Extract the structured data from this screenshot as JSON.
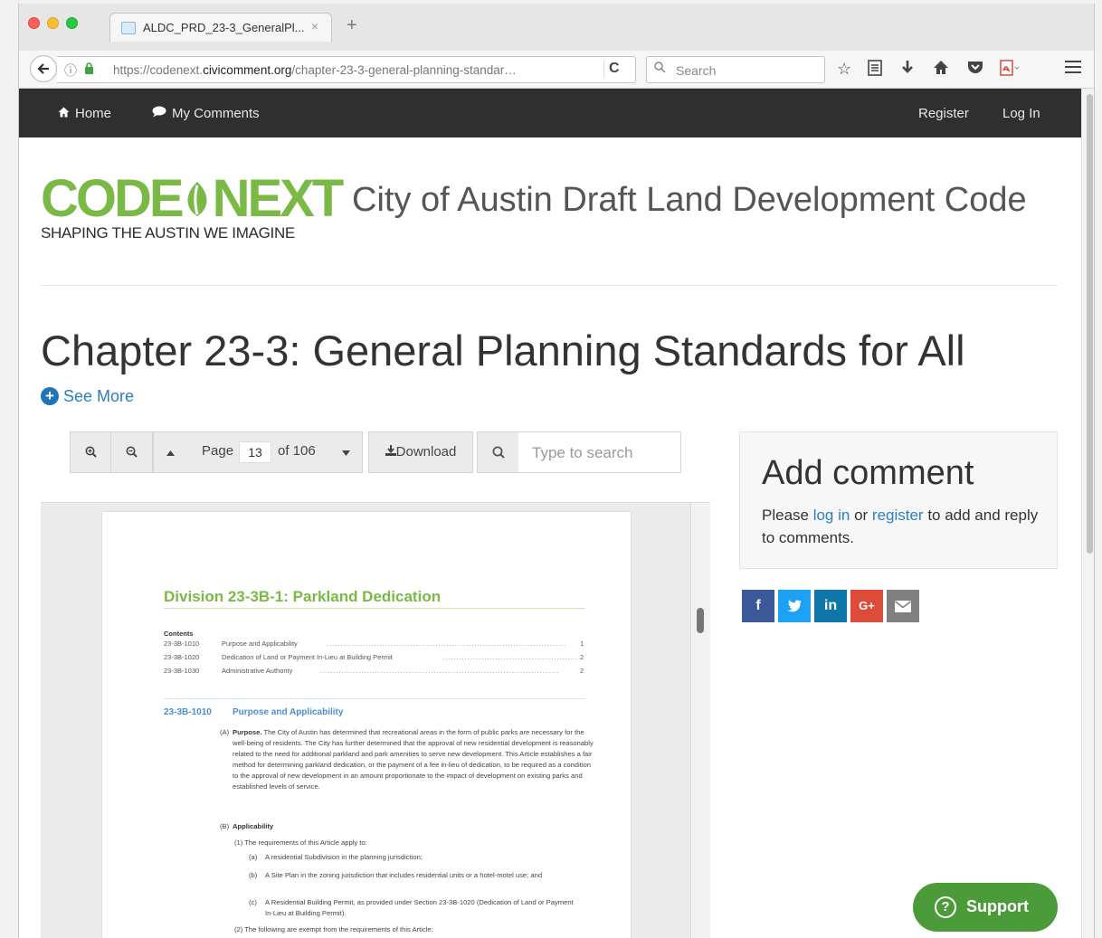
{
  "browser": {
    "tab_title": "ALDC_PRD_23-3_GeneralPl...",
    "tab_close": "×",
    "new_tab": "+",
    "url_prefix": "https://codenext.",
    "url_domain": "civicomment.org",
    "url_path": "/chapter-23-3-general-planning-standar…",
    "search_placeholder": "Search"
  },
  "site_nav": {
    "home": "Home",
    "my_comments": "My Comments",
    "register": "Register",
    "login": "Log In"
  },
  "logo": {
    "word_left": "CODE",
    "word_right": "NEXT",
    "tagline": "SHAPING THE AUSTIN WE IMAGINE"
  },
  "site_title": "City of Austin Draft Land Development Code",
  "page_title": "Chapter 23-3: General Planning Standards for All",
  "see_more": "See More",
  "viewer_toolbar": {
    "page_label": "Page",
    "page_current": "13",
    "page_total": "of 106",
    "download": "Download",
    "search_placeholder": "Type to search"
  },
  "document": {
    "division_title": "Division 23-3B-1: Parkland Dedication",
    "contents_label": "Contents",
    "toc": [
      {
        "num": "23-3B-1010",
        "title": "Purpose and Applicability",
        "page": "1"
      },
      {
        "num": "23-3B-1020",
        "title": "Dedication of Land or Payment In-Lieu at Building Permit",
        "page": "2"
      },
      {
        "num": "23-3B-1030",
        "title": "Administrative Authority",
        "page": "2"
      }
    ],
    "section_num": "23-3B-1010",
    "section_title": "Purpose and Applicability",
    "a_label": "(A)",
    "a_head": "Purpose.",
    "a_text": "The City of Austin has determined that recreational areas in the form of public parks are necessary for the well-being of residents. The City has further determined that the approval of new residential development is reasonably related to the need for additional parkland and park amenities to serve new development. This Article establishes a fair method for determining parkland dedication, or the payment of a fee in-lieu of dedication, to be required as a condition to the approval of new development in an amount proportionate to the impact of development on existing parks and established levels of service.",
    "b_label": "(B)",
    "b_head": "Applicability",
    "b1": "(1)  The requirements of this Article apply to:",
    "b1a_label": "(a)",
    "b1a": "A residential Subdivision in the planning jurisdiction;",
    "b1b_label": "(b)",
    "b1b": "A Site Plan in the zoning jurisdiction that includes residential units or a hotel-motel use; and",
    "b1c_label": "(c)",
    "b1c": "A Residential Building Permit, as provided under Section 23-3B-1020 (Dedication of Land or Payment In-Lieu at Building Permit).",
    "b2": "(2)  The following are exempt from the requirements of this Article:"
  },
  "comment_panel": {
    "heading": "Add comment",
    "text_1": "Please ",
    "login_link": "log in",
    "text_2": " or ",
    "register_link": "register",
    "text_3": " to add and reply to comments."
  },
  "social": {
    "facebook": "f",
    "twitter": "t",
    "linkedin": "in",
    "google_plus": "G+",
    "email": "✉"
  },
  "support_label": "Support",
  "colors": {
    "brand_green": "#7ab946",
    "link_blue": "#2a7fc0",
    "header_dark": "#2f2f2f",
    "support_green": "#4b9b3b",
    "facebook": "#3b5998",
    "twitter": "#1da1f2",
    "linkedin": "#0e76a8",
    "google_plus": "#dd4b39",
    "email": "#808080"
  }
}
